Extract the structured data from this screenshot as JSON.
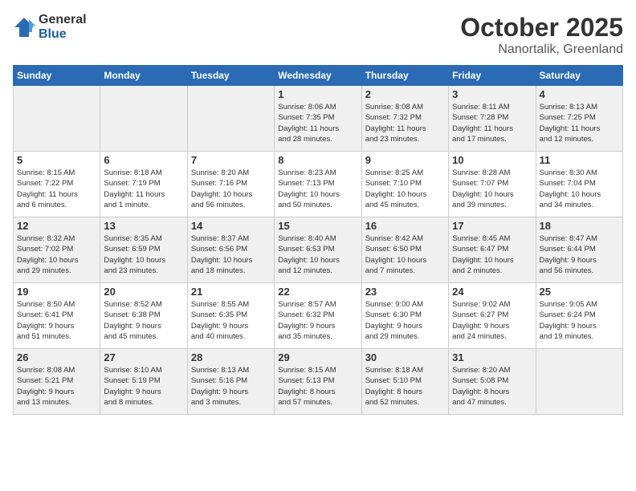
{
  "logo": {
    "general": "General",
    "blue": "Blue"
  },
  "title": "October 2025",
  "subtitle": "Nanortalik, Greenland",
  "weekdays": [
    "Sunday",
    "Monday",
    "Tuesday",
    "Wednesday",
    "Thursday",
    "Friday",
    "Saturday"
  ],
  "weeks": [
    [
      {
        "day": "",
        "info": ""
      },
      {
        "day": "",
        "info": ""
      },
      {
        "day": "",
        "info": ""
      },
      {
        "day": "1",
        "info": "Sunrise: 8:06 AM\nSunset: 7:35 PM\nDaylight: 11 hours\nand 28 minutes."
      },
      {
        "day": "2",
        "info": "Sunrise: 8:08 AM\nSunset: 7:32 PM\nDaylight: 11 hours\nand 23 minutes."
      },
      {
        "day": "3",
        "info": "Sunrise: 8:11 AM\nSunset: 7:28 PM\nDaylight: 11 hours\nand 17 minutes."
      },
      {
        "day": "4",
        "info": "Sunrise: 8:13 AM\nSunset: 7:25 PM\nDaylight: 11 hours\nand 12 minutes."
      }
    ],
    [
      {
        "day": "5",
        "info": "Sunrise: 8:15 AM\nSunset: 7:22 PM\nDaylight: 11 hours\nand 6 minutes."
      },
      {
        "day": "6",
        "info": "Sunrise: 8:18 AM\nSunset: 7:19 PM\nDaylight: 11 hours\nand 1 minute."
      },
      {
        "day": "7",
        "info": "Sunrise: 8:20 AM\nSunset: 7:16 PM\nDaylight: 10 hours\nand 56 minutes."
      },
      {
        "day": "8",
        "info": "Sunrise: 8:23 AM\nSunset: 7:13 PM\nDaylight: 10 hours\nand 50 minutes."
      },
      {
        "day": "9",
        "info": "Sunrise: 8:25 AM\nSunset: 7:10 PM\nDaylight: 10 hours\nand 45 minutes."
      },
      {
        "day": "10",
        "info": "Sunrise: 8:28 AM\nSunset: 7:07 PM\nDaylight: 10 hours\nand 39 minutes."
      },
      {
        "day": "11",
        "info": "Sunrise: 8:30 AM\nSunset: 7:04 PM\nDaylight: 10 hours\nand 34 minutes."
      }
    ],
    [
      {
        "day": "12",
        "info": "Sunrise: 8:32 AM\nSunset: 7:02 PM\nDaylight: 10 hours\nand 29 minutes."
      },
      {
        "day": "13",
        "info": "Sunrise: 8:35 AM\nSunset: 6:59 PM\nDaylight: 10 hours\nand 23 minutes."
      },
      {
        "day": "14",
        "info": "Sunrise: 8:37 AM\nSunset: 6:56 PM\nDaylight: 10 hours\nand 18 minutes."
      },
      {
        "day": "15",
        "info": "Sunrise: 8:40 AM\nSunset: 6:53 PM\nDaylight: 10 hours\nand 12 minutes."
      },
      {
        "day": "16",
        "info": "Sunrise: 8:42 AM\nSunset: 6:50 PM\nDaylight: 10 hours\nand 7 minutes."
      },
      {
        "day": "17",
        "info": "Sunrise: 8:45 AM\nSunset: 6:47 PM\nDaylight: 10 hours\nand 2 minutes."
      },
      {
        "day": "18",
        "info": "Sunrise: 8:47 AM\nSunset: 6:44 PM\nDaylight: 9 hours\nand 56 minutes."
      }
    ],
    [
      {
        "day": "19",
        "info": "Sunrise: 8:50 AM\nSunset: 6:41 PM\nDaylight: 9 hours\nand 51 minutes."
      },
      {
        "day": "20",
        "info": "Sunrise: 8:52 AM\nSunset: 6:38 PM\nDaylight: 9 hours\nand 45 minutes."
      },
      {
        "day": "21",
        "info": "Sunrise: 8:55 AM\nSunset: 6:35 PM\nDaylight: 9 hours\nand 40 minutes."
      },
      {
        "day": "22",
        "info": "Sunrise: 8:57 AM\nSunset: 6:32 PM\nDaylight: 9 hours\nand 35 minutes."
      },
      {
        "day": "23",
        "info": "Sunrise: 9:00 AM\nSunset: 6:30 PM\nDaylight: 9 hours\nand 29 minutes."
      },
      {
        "day": "24",
        "info": "Sunrise: 9:02 AM\nSunset: 6:27 PM\nDaylight: 9 hours\nand 24 minutes."
      },
      {
        "day": "25",
        "info": "Sunrise: 9:05 AM\nSunset: 6:24 PM\nDaylight: 9 hours\nand 19 minutes."
      }
    ],
    [
      {
        "day": "26",
        "info": "Sunrise: 8:08 AM\nSunset: 5:21 PM\nDaylight: 9 hours\nand 13 minutes."
      },
      {
        "day": "27",
        "info": "Sunrise: 8:10 AM\nSunset: 5:19 PM\nDaylight: 9 hours\nand 8 minutes."
      },
      {
        "day": "28",
        "info": "Sunrise: 8:13 AM\nSunset: 5:16 PM\nDaylight: 9 hours\nand 3 minutes."
      },
      {
        "day": "29",
        "info": "Sunrise: 8:15 AM\nSunset: 5:13 PM\nDaylight: 8 hours\nand 57 minutes."
      },
      {
        "day": "30",
        "info": "Sunrise: 8:18 AM\nSunset: 5:10 PM\nDaylight: 8 hours\nand 52 minutes."
      },
      {
        "day": "31",
        "info": "Sunrise: 8:20 AM\nSunset: 5:08 PM\nDaylight: 8 hours\nand 47 minutes."
      },
      {
        "day": "",
        "info": ""
      }
    ]
  ]
}
